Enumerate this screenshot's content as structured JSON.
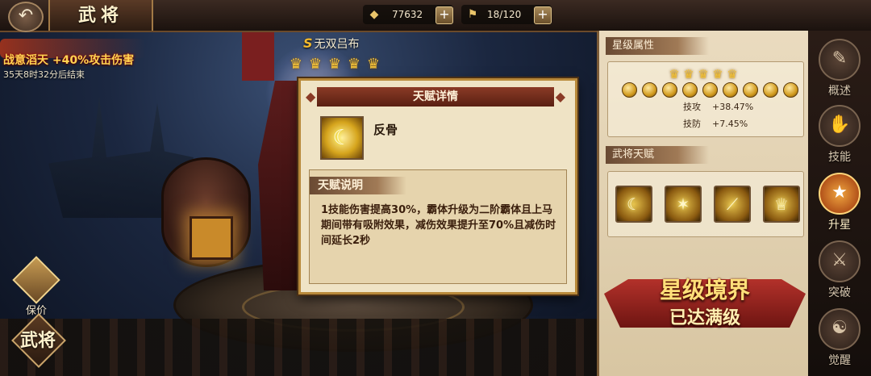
{
  "header": {
    "back_icon": "back-arrow-icon",
    "title": "武将",
    "gold": {
      "icon": "gold-ingot-icon",
      "value": "77632"
    },
    "stamina": {
      "icon": "stamina-flag-icon",
      "value": "18/120"
    },
    "plus_label": "+"
  },
  "event": {
    "title": "战意滔天 +40%攻击伤害",
    "countdown": "35天8时32分后结束"
  },
  "hero": {
    "grade": "S",
    "name": "无双吕布",
    "crowns": 5
  },
  "left_buttons": {
    "protect_label": "保价",
    "generals_label": "武将"
  },
  "modal": {
    "title": "天赋详情",
    "talent_name": "反骨",
    "desc_header": "天赋说明",
    "desc_text": "1技能伤害提高30%，霸体升级为二阶霸体且上马期间带有吸附效果，减伤效果提升至70%且减伤时间延长2秒"
  },
  "star_panel": {
    "header": "星级属性",
    "crowns": 5,
    "orbs": 9,
    "stats": [
      {
        "label": "技攻",
        "value": "+38.47%"
      },
      {
        "label": "技防",
        "value": "+7.45%"
      }
    ]
  },
  "talent_panel": {
    "header": "武将天赋",
    "icons": [
      "talent-fangu-icon",
      "talent-lightning-icon",
      "talent-slash-icon",
      "talent-bell-icon"
    ]
  },
  "star_banner": {
    "line1": "星级境界",
    "line2": "已达满级"
  },
  "nav": [
    {
      "icon": "book-icon",
      "label": "概述"
    },
    {
      "icon": "flame-hand-icon",
      "label": "技能"
    },
    {
      "icon": "star-up-icon",
      "label": "升星",
      "active": true
    },
    {
      "icon": "sword-break-icon",
      "label": "突破"
    },
    {
      "icon": "meditate-icon",
      "label": "觉醒"
    }
  ],
  "colors": {
    "accent_gold": "#f2c23b",
    "modal_title_bg": "#8a3a26",
    "active_nav": "#f0a640"
  }
}
